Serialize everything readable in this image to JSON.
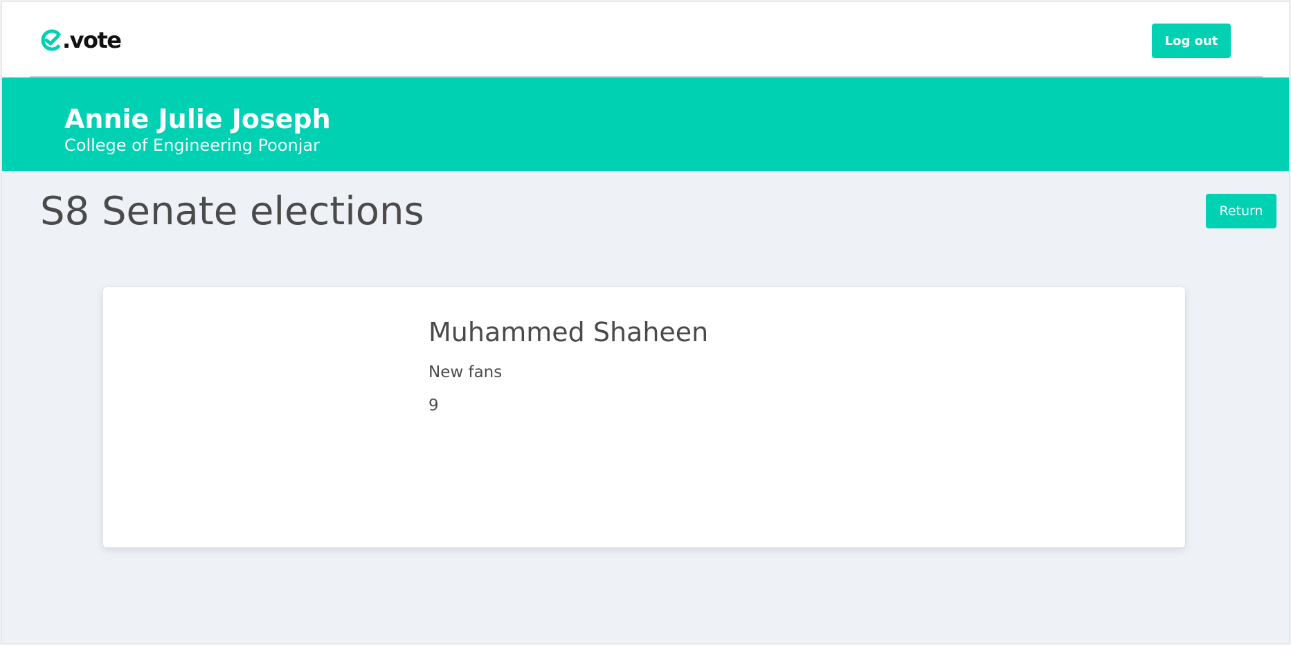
{
  "header": {
    "logo_text": ".vote",
    "logo_icon": "e-check-icon",
    "logout_label": "Log out"
  },
  "hero": {
    "user_name": "Annie Julie Joseph",
    "college": "College of Engineering Poonjar"
  },
  "election": {
    "title": "S8 Senate elections",
    "return_label": "Return"
  },
  "candidate": {
    "name": "Muhammed Shaheen",
    "tagline": "New fans",
    "votes": "9"
  },
  "colors": {
    "accent": "#00d1b2",
    "background": "#eef1f6",
    "text": "#4a4a4a"
  }
}
